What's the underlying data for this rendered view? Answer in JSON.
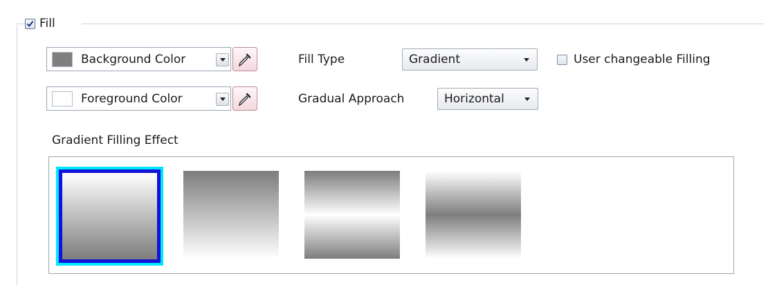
{
  "fill": {
    "label": "Fill",
    "checked": true
  },
  "background_color": {
    "label": "Background Color",
    "swatch": "#7f7f7f"
  },
  "foreground_color": {
    "label": "Foreground Color",
    "swatch": "#ffffff"
  },
  "fill_type": {
    "label": "Fill Type",
    "value": "Gradient"
  },
  "user_changeable": {
    "label": "User changeable Filling",
    "checked": false
  },
  "gradual_approach": {
    "label": "Gradual Approach",
    "value": "Horizontal"
  },
  "gradient_effect": {
    "label": "Gradient Filling Effect",
    "selected_index": 0,
    "options": [
      "light-to-dark",
      "dark-to-light",
      "dark-light-dark",
      "light-dark-light"
    ]
  },
  "colors": {
    "cyan_highlight": "#00e6ff",
    "blue_border": "#1212d9",
    "group_line": "#c9d3de"
  }
}
